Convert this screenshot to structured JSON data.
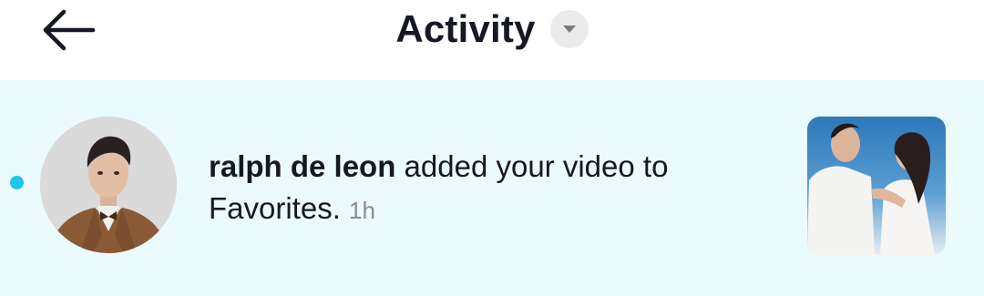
{
  "header": {
    "back_icon": "arrow-left-icon",
    "title": "Activity",
    "dropdown_icon": "caret-down-icon"
  },
  "notification": {
    "unread": true,
    "username": "ralph de leon",
    "action_text": "added your video to Favorites.",
    "time": "1h"
  },
  "colors": {
    "notification_bg": "#ebfafd",
    "unread_dot": "#20c5e8",
    "text_primary": "#161823",
    "text_secondary": "#8a8b91"
  }
}
